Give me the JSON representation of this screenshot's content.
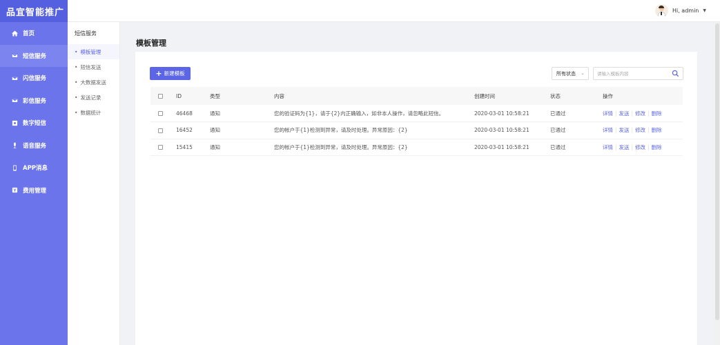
{
  "brand": "品宜智能推广",
  "main_nav": [
    {
      "label": "首页",
      "icon": "home-icon",
      "active": false
    },
    {
      "label": "短信服务",
      "icon": "mail-icon",
      "active": true
    },
    {
      "label": "闪信服务",
      "icon": "mail-icon",
      "active": false
    },
    {
      "label": "彩信服务",
      "icon": "mail-icon",
      "active": false
    },
    {
      "label": "数字短信",
      "icon": "square-icon",
      "active": false
    },
    {
      "label": "语音服务",
      "icon": "microphone-icon",
      "active": false
    },
    {
      "label": "APP消息",
      "icon": "phone-icon",
      "active": false
    },
    {
      "label": "费用管理",
      "icon": "currency-icon",
      "active": false
    }
  ],
  "user": {
    "greeting": "Hi, admin",
    "caret": "▼"
  },
  "sub_nav": {
    "title": "短信服务",
    "items": [
      {
        "label": "模板管理",
        "active": true
      },
      {
        "label": "短信发送",
        "active": false
      },
      {
        "label": "大数据发送",
        "active": false
      },
      {
        "label": "发送记录",
        "active": false
      },
      {
        "label": "数据统计",
        "active": false
      }
    ]
  },
  "page": {
    "title": "模板管理"
  },
  "toolbar": {
    "new_button": "新建模板",
    "status_select": "所有状态",
    "search_placeholder": "请输入模板内容"
  },
  "table": {
    "headers": {
      "id": "ID",
      "type": "类型",
      "content": "内容",
      "time": "创建时间",
      "status": "状态",
      "ops": "操作"
    },
    "rows": [
      {
        "id": "46468",
        "type": "通知",
        "content": "您的验证码为{1}，请于{2}内正确输入，如非本人操作，请忽略此短信。",
        "time": "2020-03-01 10:58:21",
        "status": "已通过"
      },
      {
        "id": "16452",
        "type": "通知",
        "content": "您的帐户于{1}检测到异常，请及时处理。异常原因：{2}",
        "time": "2020-03-01 10:58:21",
        "status": "已通过"
      },
      {
        "id": "15415",
        "type": "通知",
        "content": "您的帐户于{1}检测到异常，请及时处理。异常原因：{2}",
        "time": "2020-03-01 10:58:21",
        "status": "已通过"
      }
    ],
    "ops": {
      "detail": "详情",
      "send": "发送",
      "edit": "修改",
      "delete": "删除"
    }
  },
  "colors": {
    "sidebar": "#6b74ea",
    "brand_bg": "#5560e0",
    "accent": "#5b65e6"
  }
}
